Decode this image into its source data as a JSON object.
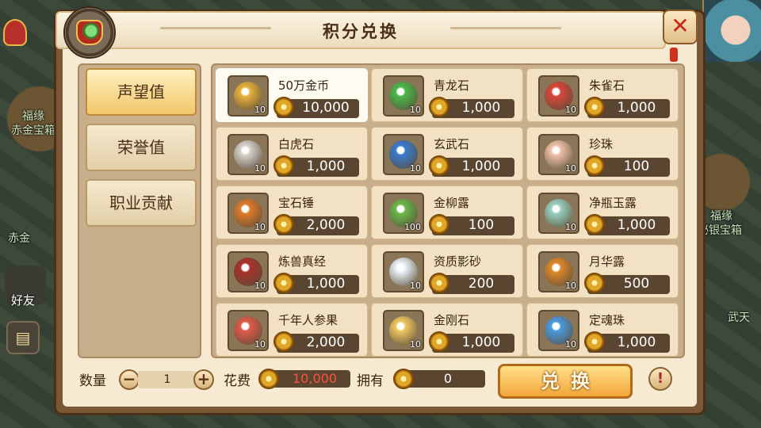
{
  "window": {
    "title": "积分兑换"
  },
  "background": {
    "labels": [
      "福缘",
      "赤金宝箱",
      "福缘",
      "赤金",
      "福缘",
      "秘银宝箱",
      "武天"
    ],
    "friend_label": "好友",
    "chat_icon": "chat-bubble-icon"
  },
  "tabs": [
    {
      "label": "声望值",
      "active": true
    },
    {
      "label": "荣誉值",
      "active": false
    },
    {
      "label": "职业贡献",
      "active": false
    }
  ],
  "items": [
    {
      "name": "50万金币",
      "count": "10",
      "price": "10,000",
      "icon": "gold-coin-bag-icon",
      "color": "#e8b23a",
      "selected": true
    },
    {
      "name": "青龙石",
      "count": "10",
      "price": "1,000",
      "icon": "green-dragon-stone-icon",
      "color": "#4bb84a",
      "selected": false
    },
    {
      "name": "朱雀石",
      "count": "10",
      "price": "1,000",
      "icon": "red-phoenix-stone-icon",
      "color": "#d8463a",
      "selected": false
    },
    {
      "name": "白虎石",
      "count": "10",
      "price": "1,000",
      "icon": "white-tiger-stone-icon",
      "color": "#d6d2cc",
      "selected": false
    },
    {
      "name": "玄武石",
      "count": "10",
      "price": "1,000",
      "icon": "black-tortoise-stone-icon",
      "color": "#3a7ad0",
      "selected": false
    },
    {
      "name": "珍珠",
      "count": "10",
      "price": "100",
      "icon": "pearl-icon",
      "color": "#f2c2aa",
      "selected": false
    },
    {
      "name": "宝石锤",
      "count": "10",
      "price": "2,000",
      "icon": "gem-hammer-icon",
      "color": "#e07a2a",
      "selected": false
    },
    {
      "name": "金柳露",
      "count": "100",
      "price": "100",
      "icon": "willow-dew-icon",
      "color": "#6ab84a",
      "selected": false
    },
    {
      "name": "净瓶玉露",
      "count": "10",
      "price": "1,000",
      "icon": "jade-vase-dew-icon",
      "color": "#9ad0c0",
      "selected": false
    },
    {
      "name": "炼兽真经",
      "count": "10",
      "price": "1,000",
      "icon": "beast-scripture-icon",
      "color": "#a8322a",
      "selected": false
    },
    {
      "name": "资质影砂",
      "count": "10",
      "price": "200",
      "icon": "crystal-ball-icon",
      "color": "#e8f2f8",
      "selected": false
    },
    {
      "name": "月华露",
      "count": "10",
      "price": "500",
      "icon": "moon-dew-gourd-icon",
      "color": "#e0882a",
      "selected": false
    },
    {
      "name": "千年人参果",
      "count": "10",
      "price": "2,000",
      "icon": "ginseng-fruit-icon",
      "color": "#e05a4a",
      "selected": false
    },
    {
      "name": "金刚石",
      "count": "10",
      "price": "1,000",
      "icon": "diamond-stone-icon",
      "color": "#f0c860",
      "selected": false
    },
    {
      "name": "定魂珠",
      "count": "10",
      "price": "1,000",
      "icon": "soul-orb-icon",
      "color": "#4a9ae0",
      "selected": false
    }
  ],
  "bottom": {
    "qty_label": "数量",
    "qty_value": "1",
    "minus": "−",
    "plus": "+",
    "cost_label": "花费",
    "cost_value": "10,000",
    "own_label": "拥有",
    "own_value": "0",
    "exchange_label": "兑换",
    "help": "!",
    "close": "✕"
  }
}
